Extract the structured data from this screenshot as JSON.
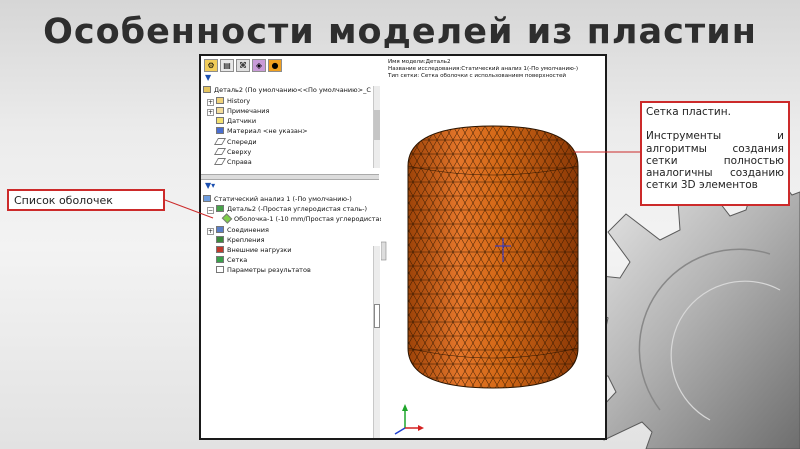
{
  "slide": {
    "title": "Особенности моделей из пластин"
  },
  "feature_manager": {
    "toolbar_icons": [
      "featuremanager-icon",
      "propertymanager-icon",
      "configurationmanager-icon",
      "display-icon",
      "appearance-icon"
    ],
    "items": [
      {
        "label": "Деталь2  (По умолчанию<<По умолчанию>_C",
        "icon": "part-icon",
        "expander": ""
      },
      {
        "label": "History",
        "icon": "history-icon",
        "expander": "+"
      },
      {
        "label": "Примечания",
        "icon": "annotations-icon",
        "expander": "+"
      },
      {
        "label": "Датчики",
        "icon": "sensors-icon",
        "expander": ""
      },
      {
        "label": "Материал <не указан>",
        "icon": "material-icon",
        "expander": ""
      },
      {
        "label": "Спереди",
        "icon": "plane-icon",
        "expander": ""
      },
      {
        "label": "Сверху",
        "icon": "plane-icon",
        "expander": ""
      },
      {
        "label": "Справа",
        "icon": "plane-icon",
        "expander": ""
      }
    ]
  },
  "simulation_tree": {
    "items": [
      {
        "label": "Статический анализ 1 (-По умолчанию-)",
        "icon": "static-study-icon",
        "expander": ""
      },
      {
        "label": "Деталь2 (-Простая углеродистая сталь-)",
        "icon": "shell-part-icon",
        "expander": "−"
      },
      {
        "label": "Оболочка-1 (-10 mm/Простая углеродистая",
        "icon": "shell-icon",
        "expander": ""
      },
      {
        "label": "Соединения",
        "icon": "connections-icon",
        "expander": "+"
      },
      {
        "label": "Крепления",
        "icon": "fixtures-icon",
        "expander": ""
      },
      {
        "label": "Внешние нагрузки",
        "icon": "loads-icon",
        "expander": ""
      },
      {
        "label": "Сетка",
        "icon": "mesh-icon",
        "expander": ""
      },
      {
        "label": "Параметры результатов",
        "icon": "result-options-icon",
        "expander": ""
      }
    ]
  },
  "viewport": {
    "info_lines": [
      "Имя модели:Деталь2",
      "Название исследования:Статический анализ 1(-По умолчанию-)",
      "Тип сетки: Сетка оболочки с использованием поверхностей"
    ]
  },
  "callouts": {
    "shell_list": "Список оболочек",
    "mesh_title": "Сетка пластин.",
    "mesh_body": "Инструменты и алгоритмы создания сетки полностью аналогичны созданию сетки 3D элементов"
  },
  "colors": {
    "mesh_fill": "#c85a14",
    "callout_border": "#cc2a2a",
    "title_text": "#2e2e2e"
  }
}
